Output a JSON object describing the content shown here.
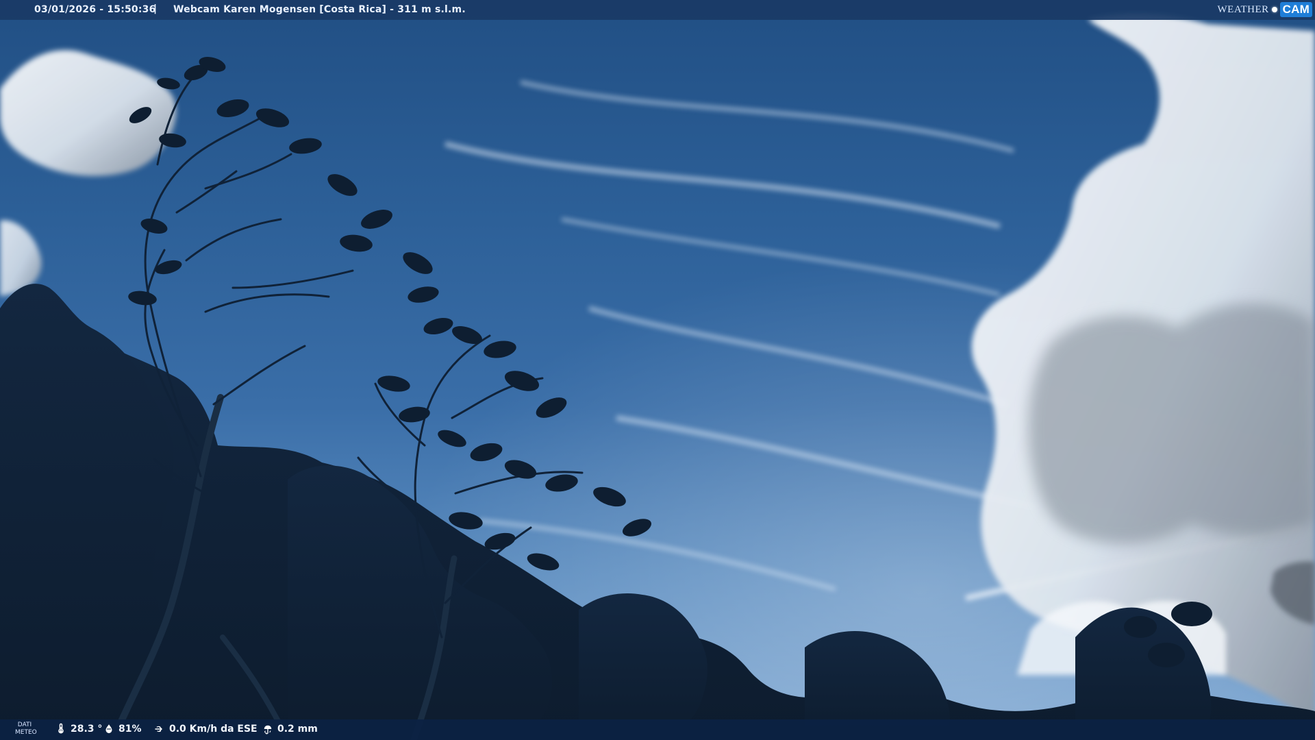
{
  "topbar": {
    "timestamp": "03/01/2026 - 15:50:36",
    "separator": "|",
    "camera_title": "Webcam Karen Mogensen [Costa Rica] - 311 m s.l.m.",
    "brand": {
      "left": "WEATHER",
      "right": "CAM"
    }
  },
  "bottombar": {
    "meteo_label_line1": "DATI",
    "meteo_label_line2": "METEO",
    "temperature": "28.3 °",
    "humidity": "81%",
    "wind": "0.0 Km/h da ESE",
    "rain": "0.2 mm"
  },
  "icons": {
    "temperature": "thermometer-icon",
    "humidity": "humidity-icon",
    "wind": "wind-icon",
    "rain": "rain-icon"
  },
  "colors": {
    "sky_top": "#214f84",
    "sky_bottom": "#7ea7d2",
    "foliage": "#102238",
    "cloud": "#f4f6f8",
    "bar_top": "#1a3a66",
    "bar_bottom": "#0b2243",
    "brand_accent": "#1f7ed8"
  }
}
